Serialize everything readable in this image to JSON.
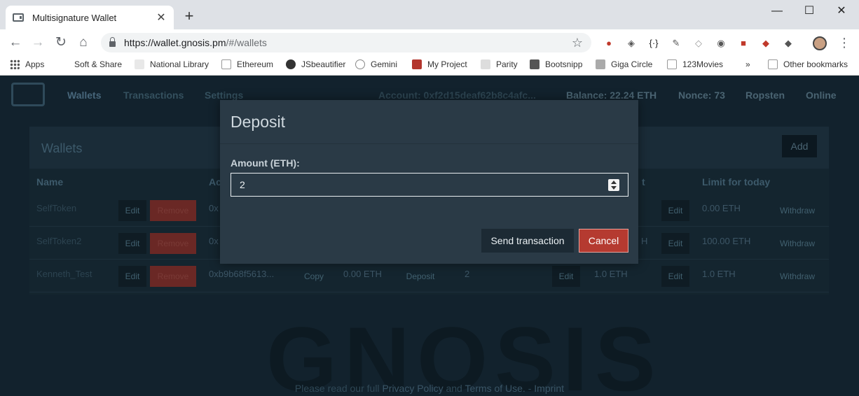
{
  "browser": {
    "tab_title": "Multisignature Wallet",
    "url_host": "https://wallet.gnosis.pm",
    "url_path": "/#/wallets",
    "bookmarks": [
      "Apps",
      "Soft & Share",
      "National Library",
      "Ethereum",
      "JSbeautifier",
      "Gemini",
      "My Project",
      "Parity",
      "Bootsnipp",
      "Giga Circle",
      "123Movies"
    ],
    "overflow": "»",
    "other_bookmarks": "Other bookmarks"
  },
  "nav": {
    "links": [
      "Wallets",
      "Transactions",
      "Settings"
    ],
    "account": "Account: 0xf2d15deaf62b8c4afc...",
    "balance": "Balance: 22.24 ETH",
    "nonce": "Nonce: 73",
    "network": "Ropsten",
    "status": "Online"
  },
  "wallets": {
    "title": "Wallets",
    "add_label": "Add",
    "columns": [
      "Name",
      "Ac",
      "",
      "",
      "t",
      "Limit for today"
    ],
    "rows": [
      {
        "name": "SelfToken",
        "address": "0x",
        "balance": "",
        "confirmations": "",
        "daily_limit": "",
        "limit_today": "0.00 ETH"
      },
      {
        "name": "SelfToken2",
        "address": "0x",
        "balance": "",
        "confirmations": "",
        "daily_limit": "H",
        "limit_today": "100.00 ETH"
      },
      {
        "name": "Kenneth_Test",
        "address": "0xb9b68f5613...",
        "balance": "0.00 ETH",
        "confirmations": "2",
        "daily_limit": "1.0 ETH",
        "limit_today": "1.0 ETH"
      }
    ],
    "edit_label": "Edit",
    "remove_label": "Remove",
    "copy_label": "Copy",
    "deposit_label": "Deposit",
    "withdraw_label": "Withdraw"
  },
  "watermark": "GNOSIS",
  "footer": {
    "prefix": "Please read our full",
    "privacy": "Privacy Policy",
    "and": "and",
    "terms": "Terms of Use.",
    "dash": "-",
    "imprint": "Imprint"
  },
  "modal": {
    "title": "Deposit",
    "amount_label": "Amount (ETH):",
    "amount_value": "2",
    "send_label": "Send transaction",
    "cancel_label": "Cancel"
  }
}
